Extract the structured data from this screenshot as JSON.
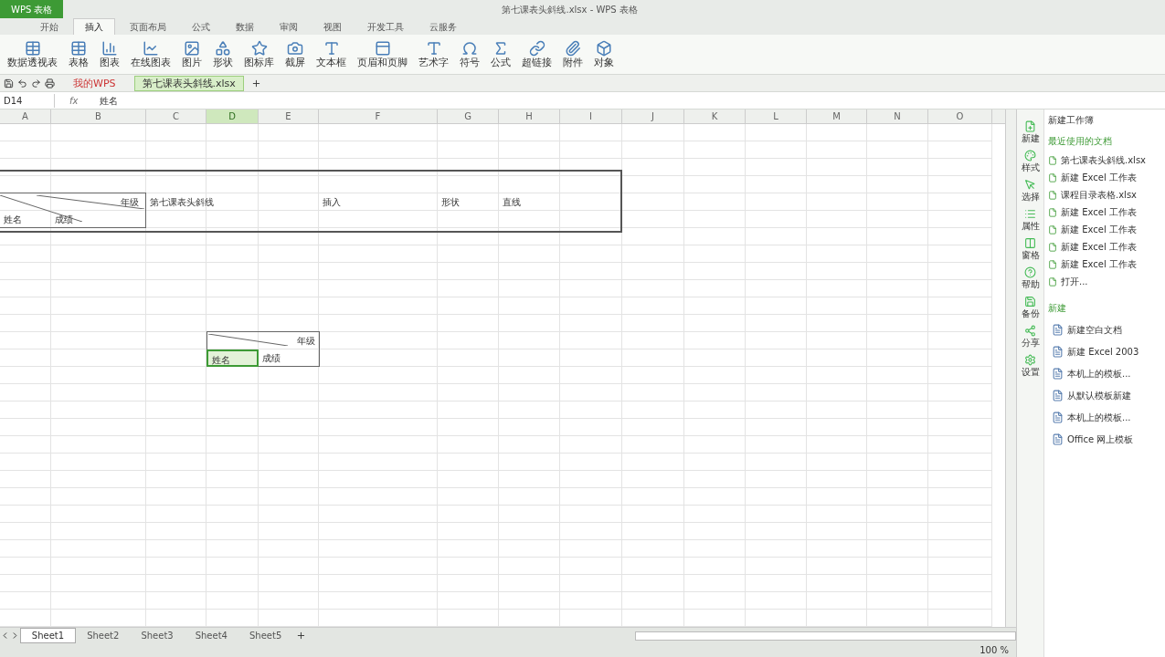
{
  "app_button": "WPS 表格",
  "window": {
    "title": "第七课表头斜线.xlsx - WPS 表格"
  },
  "menu_tabs": [
    {
      "label": "开始",
      "selected": false
    },
    {
      "label": "插入",
      "selected": true
    },
    {
      "label": "页面布局",
      "selected": false
    },
    {
      "label": "公式",
      "selected": false
    },
    {
      "label": "数据",
      "selected": false
    },
    {
      "label": "审阅",
      "selected": false
    },
    {
      "label": "视图",
      "selected": false
    },
    {
      "label": "开发工具",
      "selected": false
    },
    {
      "label": "云服务",
      "selected": false
    }
  ],
  "ribbon": [
    "数据透视表",
    "表格",
    "图表",
    "在线图表",
    "图片",
    "形状",
    "图标库",
    "截屏",
    "文本框",
    "页眉和页脚",
    "艺术字",
    "符号",
    "公式",
    "超链接",
    "附件",
    "对象"
  ],
  "doc_tabs": [
    {
      "label": "我的WPS",
      "selected": false
    },
    {
      "label": "第七课表头斜线.xlsx",
      "selected": true
    }
  ],
  "formula_bar": {
    "name_box": "D14",
    "fx": "fx",
    "value": "姓名"
  },
  "columns": [
    {
      "label": "A",
      "selected": false
    },
    {
      "label": "B",
      "selected": false
    },
    {
      "label": "C",
      "selected": false
    },
    {
      "label": "D",
      "selected": true
    },
    {
      "label": "E",
      "selected": false
    },
    {
      "label": "F",
      "selected": false
    },
    {
      "label": "G",
      "selected": false
    },
    {
      "label": "H",
      "selected": false
    },
    {
      "label": "I",
      "selected": false
    },
    {
      "label": "J",
      "selected": false
    },
    {
      "label": "K",
      "selected": false
    },
    {
      "label": "L",
      "selected": false
    },
    {
      "label": "M",
      "selected": false
    },
    {
      "label": "N",
      "selected": false
    },
    {
      "label": "O",
      "selected": false
    }
  ],
  "lesson_table": {
    "corner_top": "年级",
    "corner_left": "姓名",
    "corner_right": "成绩",
    "title": "第七课表头斜线",
    "steps": [
      "插入",
      "形状",
      "直线"
    ]
  },
  "small_table": {
    "corner_top": "年级",
    "name_cell": {
      "text": "姓名",
      "selected": true
    },
    "score_cell": {
      "text": "成绩",
      "selected": false
    }
  },
  "sheet_tabs": [
    {
      "label": "Sheet1",
      "selected": true
    },
    {
      "label": "Sheet2",
      "selected": false
    },
    {
      "label": "Sheet3",
      "selected": false
    },
    {
      "label": "Sheet4",
      "selected": false
    },
    {
      "label": "Sheet5",
      "selected": false
    }
  ],
  "side_strip": [
    "新建",
    "样式",
    "选择",
    "属性",
    "窗格",
    "帮助",
    "备份",
    "分享",
    "设置"
  ],
  "task_pane": {
    "title": "新建工作簿",
    "recent_heading": "最近使用的文档",
    "recent": [
      "第七课表头斜线.xlsx",
      "新建 Excel 工作表",
      "课程目录表格.xlsx",
      "新建 Excel 工作表",
      "新建 Excel 工作表",
      "新建 Excel 工作表",
      "新建 Excel 工作表",
      "打开..."
    ],
    "new_heading": "新建",
    "new_items": [
      "新建空白文档",
      "新建 Excel 2003",
      "本机上的模板...",
      "从默认模板新建",
      "本机上的模板...",
      "Office 网上模板"
    ]
  },
  "status_bar": {
    "zoom": "100 %"
  }
}
